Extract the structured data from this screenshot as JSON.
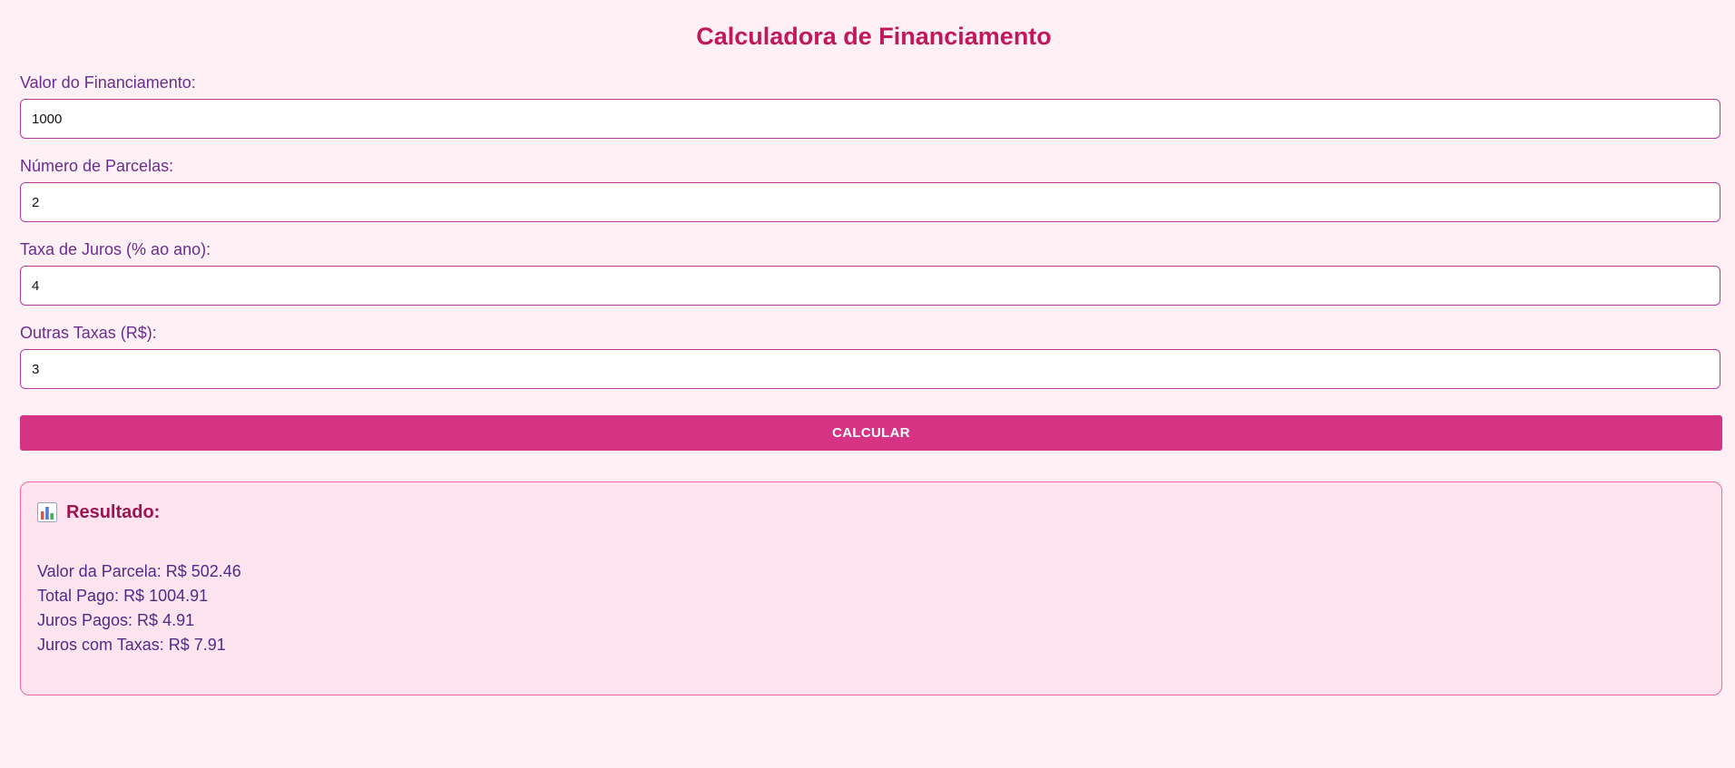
{
  "title": "Calculadora de Financiamento",
  "fields": [
    {
      "label": "Valor do Financiamento:",
      "value": "1000"
    },
    {
      "label": "Número de Parcelas:",
      "value": "2"
    },
    {
      "label": "Taxa de Juros (% ao ano):",
      "value": "4"
    },
    {
      "label": "Outras Taxas (R$):",
      "value": "3"
    }
  ],
  "button": {
    "label": "CALCULAR"
  },
  "result": {
    "icon": "bar-chart-icon",
    "title": "Resultado:",
    "lines": [
      "Valor da Parcela: R$ 502.46",
      "Total Pago: R$ 1004.91",
      "Juros Pagos: R$ 4.91",
      "Juros com Taxas: R$ 7.91"
    ]
  },
  "colors": {
    "background": "#fef0f5",
    "title": "#c2185b",
    "label": "#6a2c91",
    "button": "#d63384",
    "result_bg": "#ffe4ef",
    "result_border": "#f06aa8"
  }
}
